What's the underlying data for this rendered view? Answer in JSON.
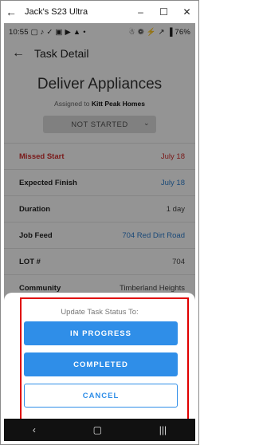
{
  "window": {
    "title": "Jack's S23 Ultra",
    "back_glyph": "←",
    "minimize_glyph": "–",
    "maximize_glyph": "☐",
    "close_glyph": "✕"
  },
  "statusbar": {
    "time": "10:55",
    "left_icons": "▢ ♪ ✓ ▣ ▶ ▲ •",
    "right_icons": "☃ ❁ ⚡ ↗ ▐",
    "battery": "76%"
  },
  "appbar": {
    "back_glyph": "←",
    "title": "Task Detail"
  },
  "task": {
    "name": "Deliver Appliances",
    "assigned_prefix": "Assigned to",
    "assigned_to": "Kitt Peak Homes",
    "status_value": "NOT STARTED",
    "status_chevron": "⌄"
  },
  "details": [
    {
      "label": "Missed Start",
      "value": "July 18"
    },
    {
      "label": "Expected Finish",
      "value": "July 18"
    },
    {
      "label": "Duration",
      "value": "1 day"
    },
    {
      "label": "Job Feed",
      "value": "704 Red Dirt Road"
    },
    {
      "label": "LOT #",
      "value": "704"
    },
    {
      "label": "Community",
      "value": "Timberland Heights"
    }
  ],
  "sheet": {
    "title": "Update Task Status To:",
    "in_progress_label": "IN PROGRESS",
    "completed_label": "COMPLETED",
    "cancel_label": "CANCEL"
  },
  "navbar": {
    "back_glyph": "‹",
    "home_glyph": "▢",
    "recents_glyph": "|||"
  },
  "colors": {
    "accent": "#2f8ee8",
    "missed": "#d32f2f",
    "link": "#2f7fcf",
    "highlight": "#e00000"
  }
}
